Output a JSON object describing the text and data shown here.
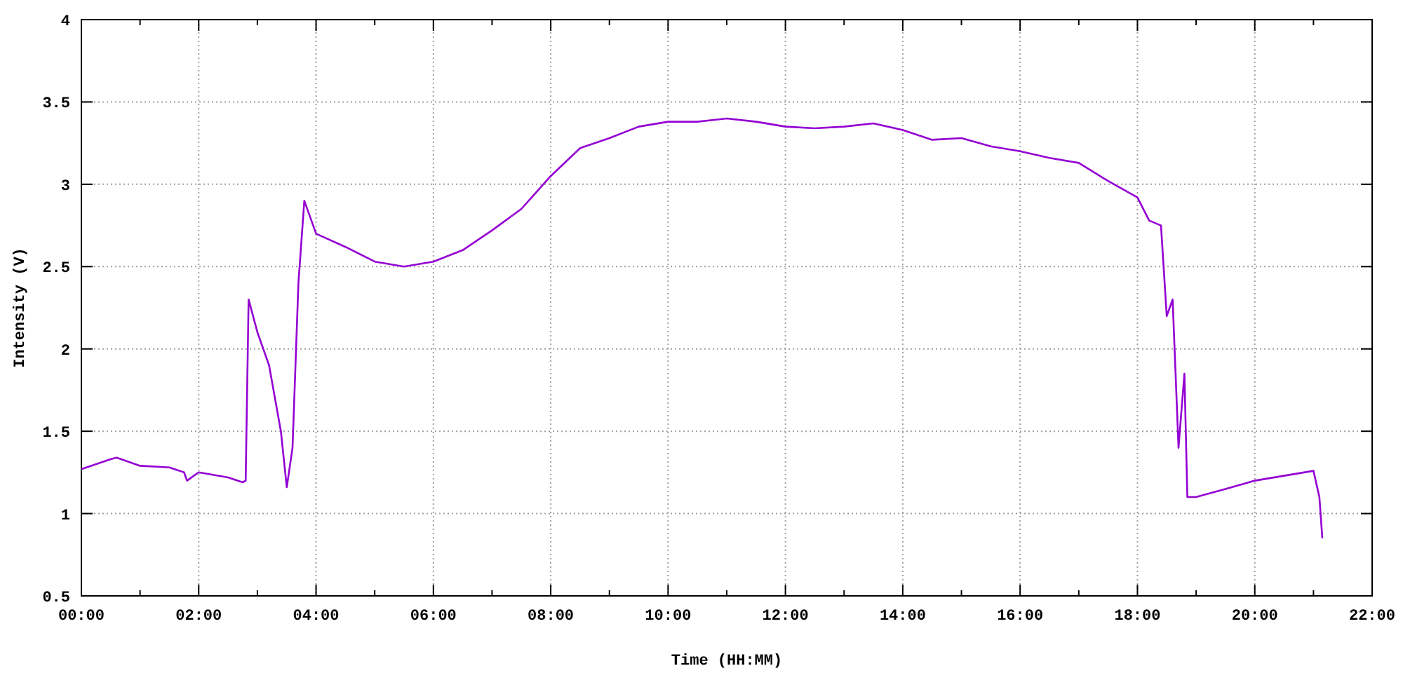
{
  "plot": {
    "chart_data": {
      "type": "line",
      "xlabel": "Time (HH:MM)",
      "ylabel": "Intensity (V)",
      "x": [
        0,
        0.5,
        0.6,
        1,
        1.5,
        1.75,
        1.8,
        2,
        2.5,
        2.75,
        2.8,
        2.85,
        3,
        3.2,
        3.4,
        3.5,
        3.6,
        3.7,
        3.8,
        4,
        4.5,
        5,
        5.5,
        6,
        6.5,
        7,
        7.5,
        8,
        8.5,
        9,
        9.5,
        10,
        10.5,
        11,
        11.5,
        12,
        12.5,
        13,
        13.5,
        14,
        14.5,
        15,
        15.5,
        16,
        16.5,
        17,
        17.5,
        18,
        18.2,
        18.4,
        18.5,
        18.6,
        18.7,
        18.8,
        18.85,
        19,
        19.5,
        20,
        20.5,
        21,
        21.1,
        21.15
      ],
      "series": [
        {
          "color": "#9400d3",
          "values": [
            1.27,
            1.33,
            1.34,
            1.29,
            1.28,
            1.25,
            1.2,
            1.25,
            1.22,
            1.19,
            1.2,
            2.3,
            2.1,
            1.9,
            1.5,
            1.16,
            1.4,
            2.4,
            2.9,
            2.7,
            2.62,
            2.53,
            2.5,
            2.53,
            2.6,
            2.72,
            2.85,
            3.05,
            3.22,
            3.28,
            3.35,
            3.38,
            3.38,
            3.4,
            3.38,
            3.35,
            3.34,
            3.35,
            3.37,
            3.33,
            3.27,
            3.28,
            3.23,
            3.2,
            3.16,
            3.13,
            3.02,
            2.92,
            2.78,
            2.75,
            2.2,
            2.3,
            1.4,
            1.85,
            1.1,
            1.1,
            1.15,
            1.2,
            1.23,
            1.26,
            1.1,
            0.85
          ]
        }
      ],
      "grid": true,
      "xlim": [
        0,
        22
      ],
      "ylim": [
        0.5,
        4
      ],
      "xticks": [
        {
          "value": 0,
          "label": "00:00"
        },
        {
          "value": 2,
          "label": "02:00"
        },
        {
          "value": 4,
          "label": "04:00"
        },
        {
          "value": 6,
          "label": "06:00"
        },
        {
          "value": 8,
          "label": "08:00"
        },
        {
          "value": 10,
          "label": "10:00"
        },
        {
          "value": 12,
          "label": "12:00"
        },
        {
          "value": 14,
          "label": "14:00"
        },
        {
          "value": 16,
          "label": "16:00"
        },
        {
          "value": 18,
          "label": "18:00"
        },
        {
          "value": 20,
          "label": "20:00"
        },
        {
          "value": 22,
          "label": "22:00"
        }
      ],
      "yticks": [
        0.5,
        1,
        1.5,
        2,
        2.5,
        3,
        3.5,
        4
      ]
    }
  }
}
